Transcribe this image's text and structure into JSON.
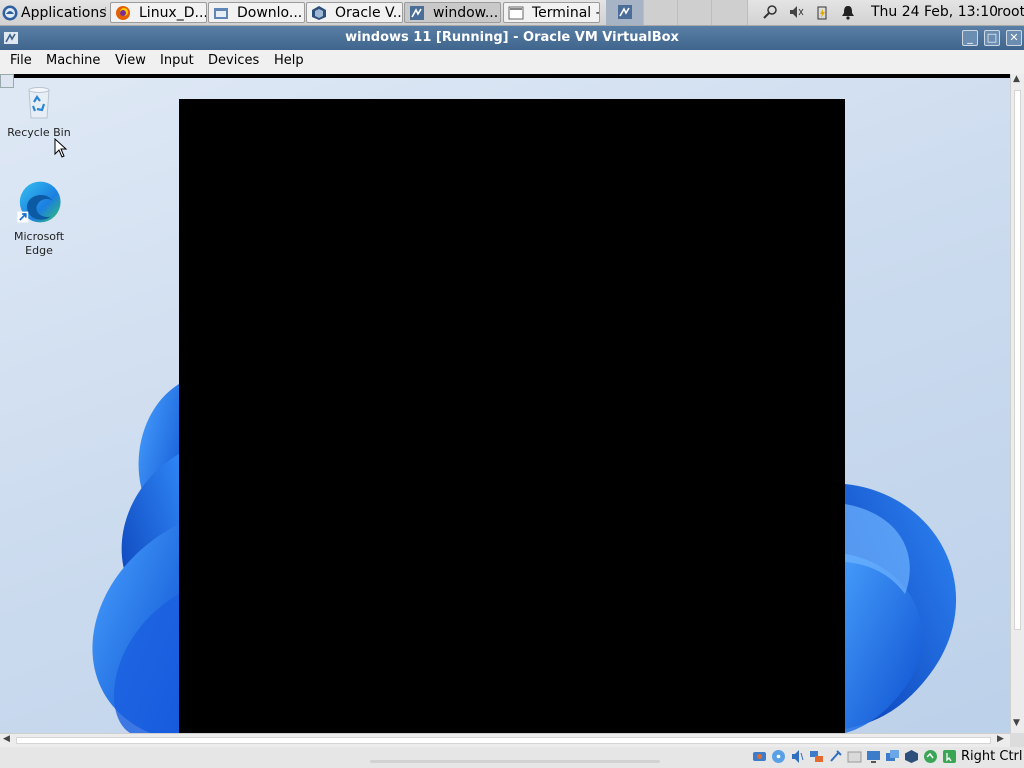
{
  "panel": {
    "applications_label": "Applications",
    "tasks": [
      {
        "label": "Linux_D...",
        "icon": "firefox-icon"
      },
      {
        "label": "Downlo...",
        "icon": "file-manager-icon"
      },
      {
        "label": "Oracle V...",
        "icon": "virtualbox-icon"
      },
      {
        "label": "window...",
        "icon": "vm-window-icon"
      },
      {
        "label": "Terminal -",
        "icon": "terminal-icon"
      }
    ],
    "clock": "Thu 24 Feb, 13:10",
    "user": "root"
  },
  "window": {
    "title": "windows 11 [Running] - Oracle VM VirtualBox",
    "menus": [
      "File",
      "Machine",
      "View",
      "Input",
      "Devices",
      "Help"
    ]
  },
  "desktop": {
    "icons": [
      {
        "label": "Recycle Bin",
        "icon": "recycle-bin-icon"
      },
      {
        "label": "Microsoft Edge",
        "icon": "edge-icon"
      }
    ]
  },
  "statusbar": {
    "host_key": "Right Ctrl"
  },
  "colors": {
    "titlebar": "#4a6f97",
    "wallpaper_bloom": "#1f66e0",
    "guest_black_area": "#000000"
  }
}
